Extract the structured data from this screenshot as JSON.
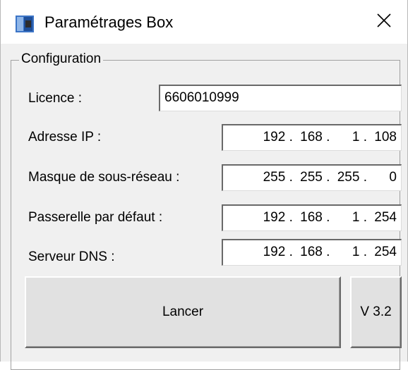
{
  "window": {
    "title": "Paramétrages Box",
    "icon": "box-app-icon",
    "close_icon": "close-icon"
  },
  "config": {
    "group_label": "Configuration",
    "licence": {
      "label": "Licence :",
      "value": "6606010999"
    },
    "ip": {
      "label": "Adresse IP :",
      "octets": [
        "192",
        "168",
        "1",
        "108"
      ]
    },
    "mask": {
      "label": "Masque de sous-réseau :",
      "octets": [
        "255",
        "255",
        "255",
        "0"
      ]
    },
    "gateway": {
      "label": "Passerelle par défaut :",
      "octets": [
        "192",
        "168",
        "1",
        "254"
      ]
    },
    "dns": {
      "label": "Serveur DNS :",
      "octets": [
        "192",
        "168",
        "1",
        "254"
      ]
    }
  },
  "buttons": {
    "launch_label": "Lancer",
    "version_label": "V 3.2"
  }
}
